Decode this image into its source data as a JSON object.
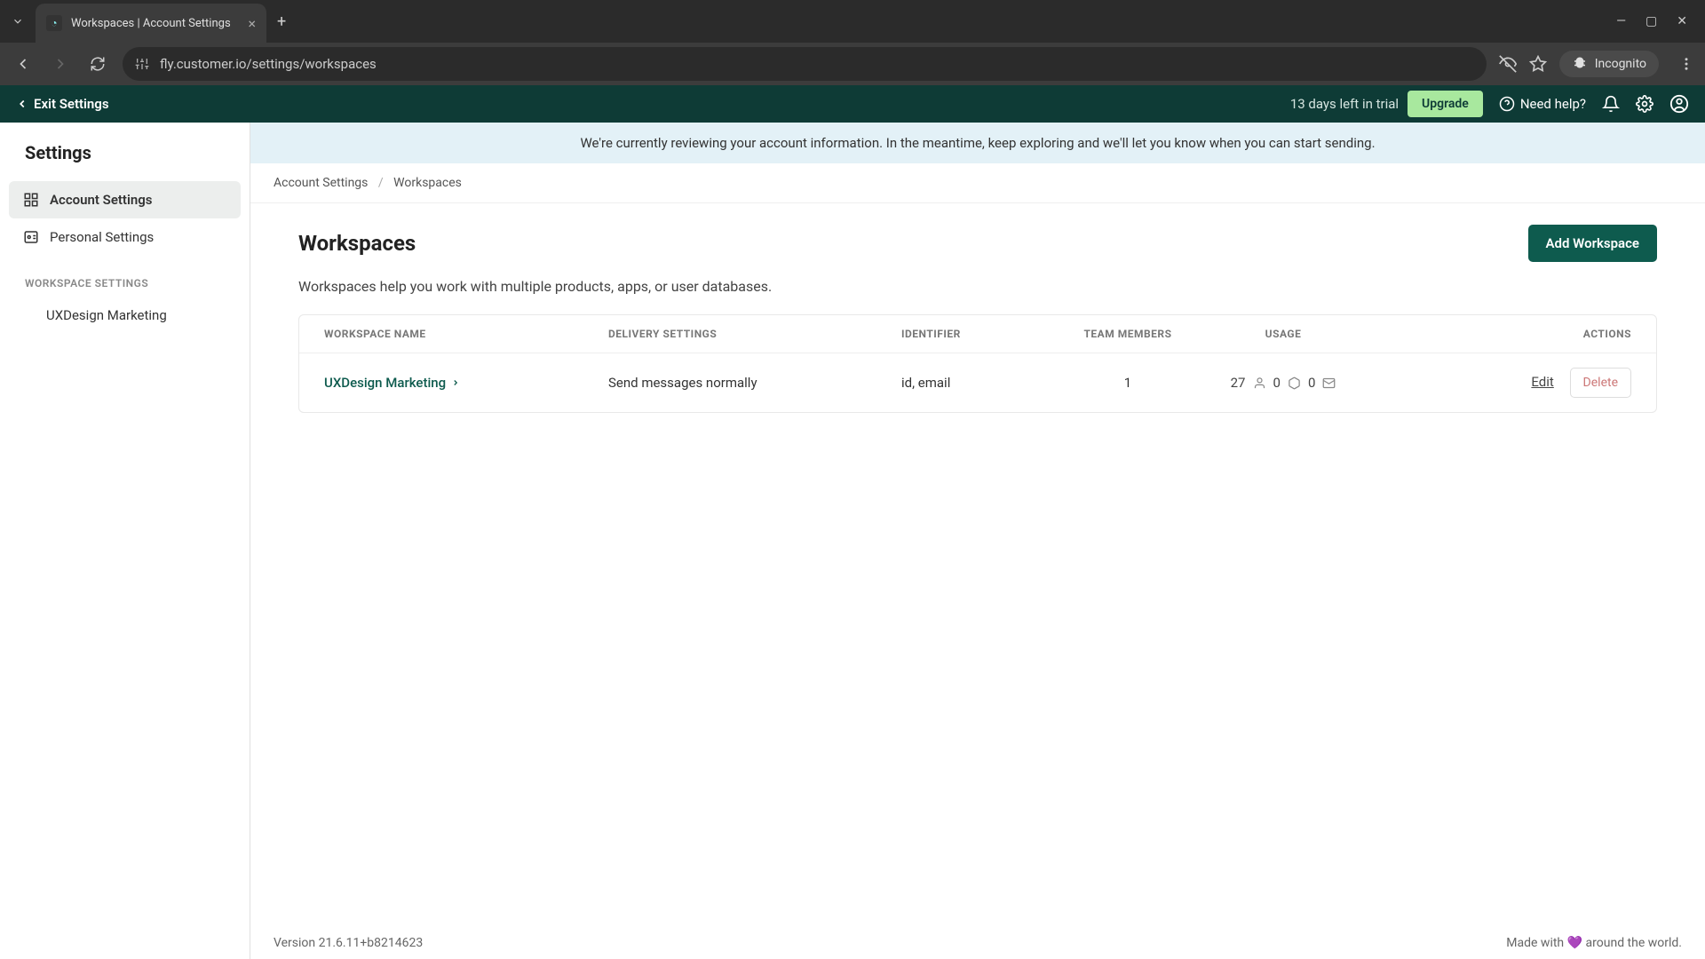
{
  "browser": {
    "tab_title": "Workspaces | Account Settings",
    "url": "fly.customer.io/settings/workspaces",
    "incognito_label": "Incognito"
  },
  "header": {
    "exit_label": "Exit Settings",
    "trial_text": "13 days left in trial",
    "upgrade_label": "Upgrade",
    "need_help_label": "Need help?"
  },
  "sidebar": {
    "title": "Settings",
    "items": [
      {
        "label": "Account Settings"
      },
      {
        "label": "Personal Settings"
      }
    ],
    "section_title": "WORKSPACE SETTINGS",
    "sub_items": [
      {
        "label": "UXDesign Marketing"
      }
    ]
  },
  "banner": {
    "text": "We're currently reviewing your account information. In the meantime, keep exploring and we'll let you know when you can start sending."
  },
  "breadcrumbs": {
    "parent": "Account Settings",
    "current": "Workspaces"
  },
  "page": {
    "title": "Workspaces",
    "add_button": "Add Workspace",
    "description": "Workspaces help you work with multiple products, apps, or user databases."
  },
  "table": {
    "headers": {
      "name": "WORKSPACE NAME",
      "delivery": "DELIVERY SETTINGS",
      "identifier": "IDENTIFIER",
      "members": "TEAM MEMBERS",
      "usage": "USAGE",
      "actions": "ACTIONS"
    },
    "rows": [
      {
        "name": "UXDesign Marketing",
        "delivery": "Send messages normally",
        "identifier": "id, email",
        "members": "1",
        "usage_people": "27",
        "usage_objects": "0",
        "usage_messages": "0",
        "edit_label": "Edit",
        "delete_label": "Delete"
      }
    ]
  },
  "footer": {
    "version": "Version 21.6.11+b8214623",
    "made_with_pre": "Made with ",
    "made_with_post": " around the world."
  }
}
